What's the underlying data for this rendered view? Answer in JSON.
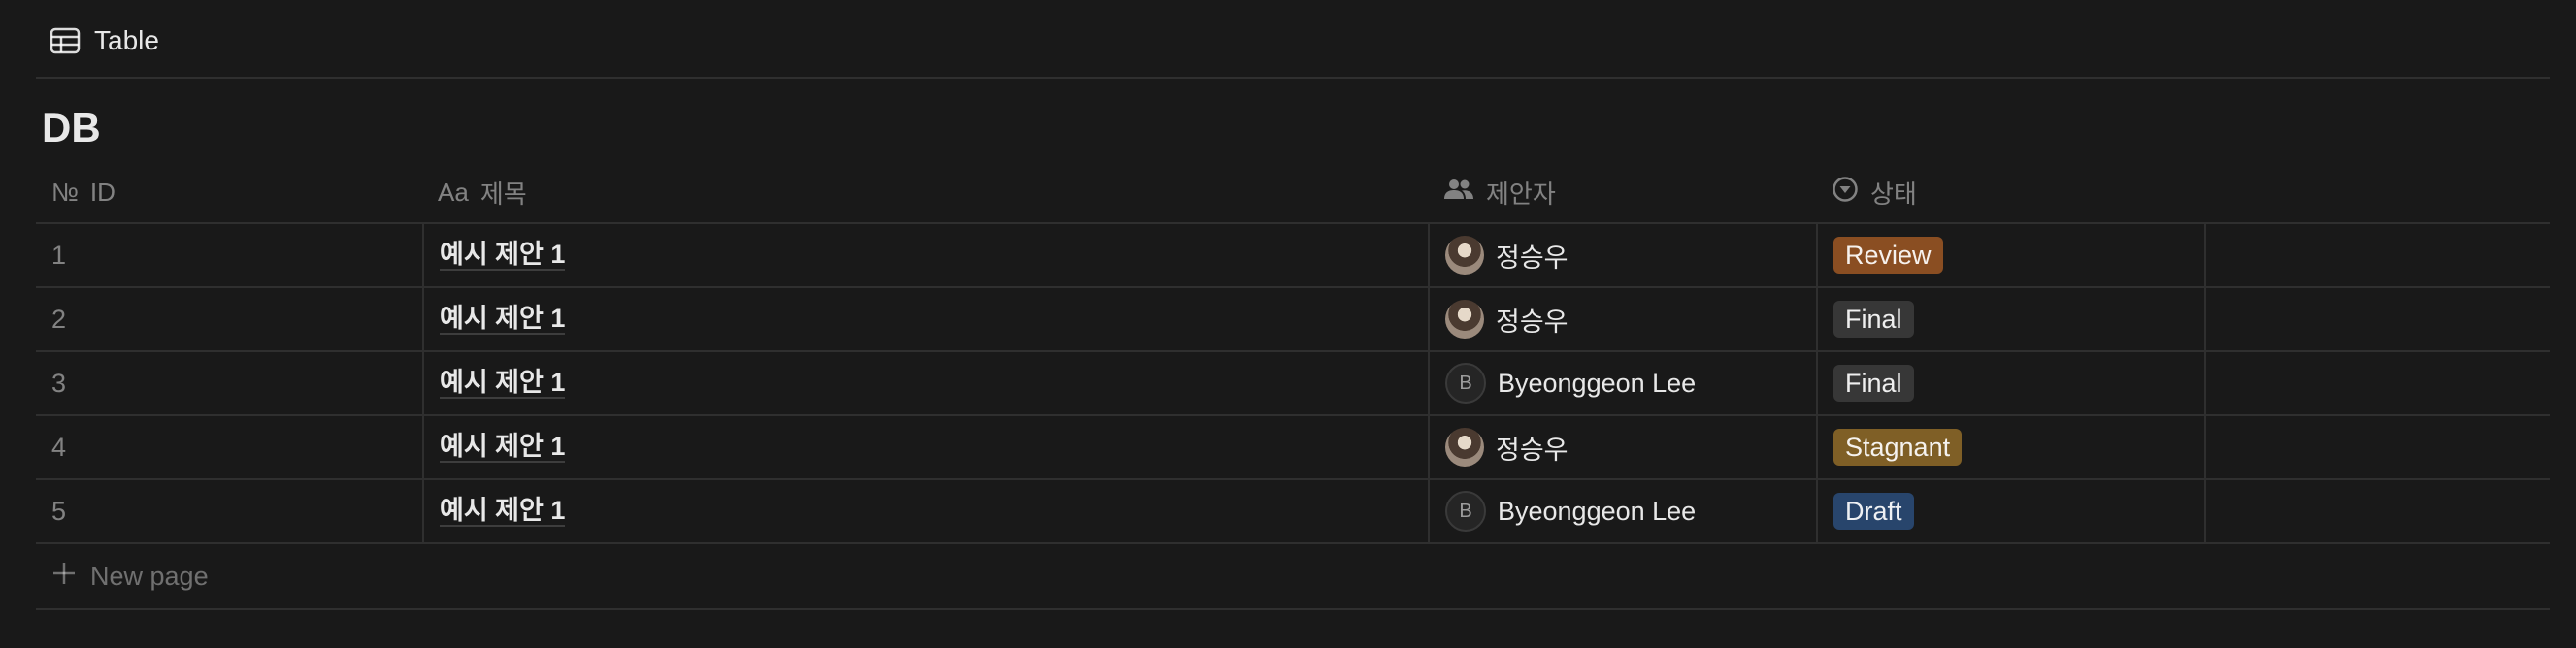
{
  "view": {
    "tab_label": "Table"
  },
  "database": {
    "title": "DB"
  },
  "columns": {
    "id": "ID",
    "title": "제목",
    "person": "제안자",
    "status": "상태"
  },
  "rows": [
    {
      "id": "1",
      "title": "예시 제안 1",
      "person": "정승우",
      "person_type": "photo",
      "status": "Review",
      "status_color": "#8a4e22"
    },
    {
      "id": "2",
      "title": "예시 제안 1",
      "person": "정승우",
      "person_type": "photo",
      "status": "Final",
      "status_color": "#373737"
    },
    {
      "id": "3",
      "title": "예시 제안 1",
      "person": "Byeonggeon Lee",
      "person_type": "initial",
      "initial": "B",
      "status": "Final",
      "status_color": "#373737"
    },
    {
      "id": "4",
      "title": "예시 제안 1",
      "person": "정승우",
      "person_type": "photo",
      "status": "Stagnant",
      "status_color": "#7f5f26"
    },
    {
      "id": "5",
      "title": "예시 제안 1",
      "person": "Byeonggeon Lee",
      "person_type": "initial",
      "initial": "B",
      "status": "Draft",
      "status_color": "#28456c"
    }
  ],
  "new_page_label": "New page"
}
